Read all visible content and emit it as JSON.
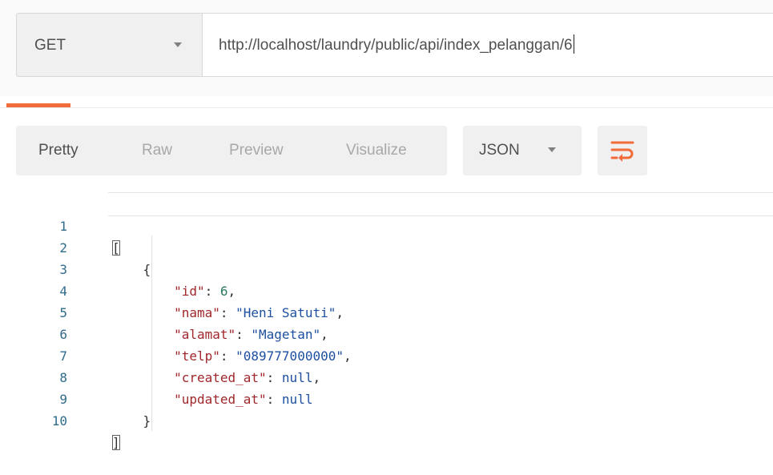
{
  "request": {
    "method": "GET",
    "url": "http://localhost/laundry/public/api/index_pelanggan/6"
  },
  "response_view": {
    "tabs": [
      "Pretty",
      "Raw",
      "Preview",
      "Visualize"
    ],
    "active_tab": "Pretty",
    "format": "JSON",
    "wrap_icon": "wrap-lines-icon"
  },
  "body": {
    "line_numbers": [
      "1",
      "2",
      "3",
      "4",
      "5",
      "6",
      "7",
      "8",
      "9",
      "10"
    ],
    "open_bracket": "[",
    "open_brace": "{",
    "fields": [
      {
        "key": "\"id\"",
        "value": "6",
        "type": "num",
        "comma": ","
      },
      {
        "key": "\"nama\"",
        "value": "\"Heni Satuti\"",
        "type": "str",
        "comma": ","
      },
      {
        "key": "\"alamat\"",
        "value": "\"Magetan\"",
        "type": "str",
        "comma": ","
      },
      {
        "key": "\"telp\"",
        "value": "\"089777000000\"",
        "type": "str",
        "comma": ","
      },
      {
        "key": "\"created_at\"",
        "value": "null",
        "type": "null",
        "comma": ","
      },
      {
        "key": "\"updated_at\"",
        "value": "null",
        "type": "null",
        "comma": ""
      }
    ],
    "close_brace": "}",
    "close_bracket": "]"
  },
  "colors": {
    "accent": "#f26b3a",
    "key": "#a0272b",
    "number": "#2b7a5f",
    "string": "#1e4fa0"
  }
}
